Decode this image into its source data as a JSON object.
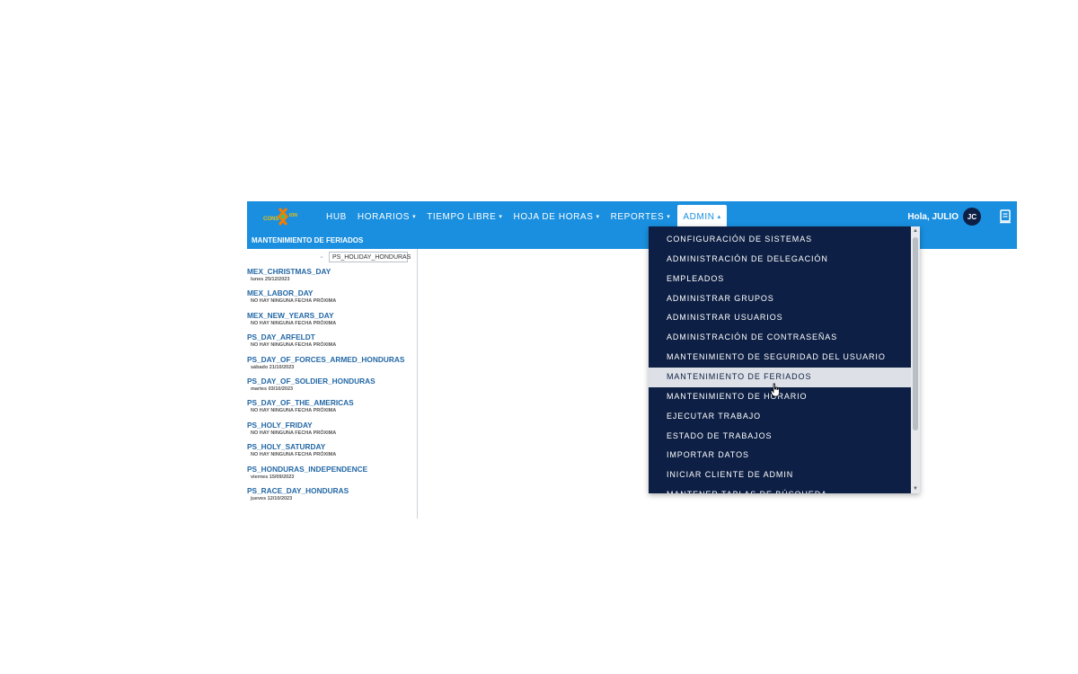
{
  "header": {
    "logo_text": "CONS ION",
    "nav": [
      {
        "label": "HUB",
        "caret": ""
      },
      {
        "label": "HORARIOS",
        "caret": "▾"
      },
      {
        "label": "TIEMPO LIBRE",
        "caret": "▾"
      },
      {
        "label": "HOJA DE HORAS",
        "caret": "▾"
      },
      {
        "label": "REPORTES",
        "caret": "▾"
      },
      {
        "label": "ADMIN",
        "caret": "▴"
      }
    ],
    "greeting": "Hola, JULIO",
    "avatar_initials": "JC"
  },
  "subheader": {
    "title": "MANTENIMIENTO DE FERIADOS"
  },
  "filter": {
    "chevron": "⌄",
    "value": "PS_HOLIDAY_HONDURAS"
  },
  "holidays": [
    {
      "name": "MEX_CHRISTMAS_DAY",
      "date": "lunes 25/12/2023"
    },
    {
      "name": "MEX_LABOR_DAY",
      "date": "NO HAY NINGUNA FECHA PRÓXIMA"
    },
    {
      "name": "MEX_NEW_YEARS_DAY",
      "date": "NO HAY NINGUNA FECHA PRÓXIMA"
    },
    {
      "name": "PS_DAY_ARFELDT",
      "date": "NO HAY NINGUNA FECHA PRÓXIMA"
    },
    {
      "name": "PS_DAY_OF_FORCES_ARMED_HONDURAS",
      "date": "sábado 21/10/2023"
    },
    {
      "name": "PS_DAY_OF_SOLDIER_HONDURAS",
      "date": "martes 03/10/2023"
    },
    {
      "name": "PS_DAY_OF_THE_AMERICAS",
      "date": "NO HAY NINGUNA FECHA PRÓXIMA"
    },
    {
      "name": "PS_HOLY_FRIDAY",
      "date": "NO HAY NINGUNA FECHA PRÓXIMA"
    },
    {
      "name": "PS_HOLY_SATURDAY",
      "date": "NO HAY NINGUNA FECHA PRÓXIMA"
    },
    {
      "name": "PS_HONDURAS_INDEPENDENCE",
      "date": "viernes 15/09/2023"
    },
    {
      "name": "PS_RACE_DAY_HONDURAS",
      "date": "jueves 12/10/2023"
    }
  ],
  "admin_menu": [
    {
      "label": "CONFIGURACIÓN DE SISTEMAS"
    },
    {
      "label": "ADMINISTRACIÓN DE DELEGACIÓN"
    },
    {
      "label": "EMPLEADOS"
    },
    {
      "label": "ADMINISTRAR GRUPOS"
    },
    {
      "label": "ADMINISTRAR USUARIOS"
    },
    {
      "label": "ADMINISTRACIÓN DE CONTRASEÑAS"
    },
    {
      "label": "MANTENIMIENTO DE SEGURIDAD DEL USUARIO"
    },
    {
      "label": "MANTENIMIENTO DE FERIADOS"
    },
    {
      "label": "MANTENIMIENTO DE HORARIO"
    },
    {
      "label": "EJECUTAR TRABAJO"
    },
    {
      "label": "ESTADO DE TRABAJOS"
    },
    {
      "label": "IMPORTAR DATOS"
    },
    {
      "label": "INICIAR CLIENTE DE ADMIN"
    },
    {
      "label": "MANTENER TABLAS DE BÚSQUEDA"
    }
  ],
  "admin_menu_hover_index": 7,
  "colors": {
    "topbar": "#1a8fdf",
    "dropdown_bg": "#0d1f44",
    "link": "#2368a6",
    "hover_bg": "#dde1e7"
  }
}
